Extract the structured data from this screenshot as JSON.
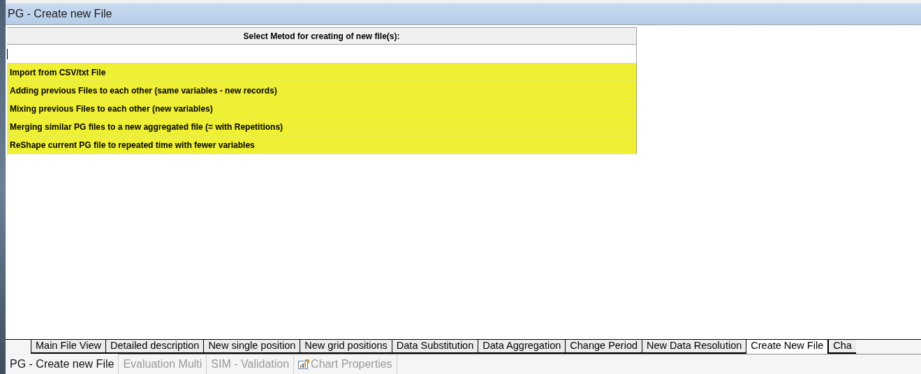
{
  "window": {
    "title": "PG - Create new File"
  },
  "grid": {
    "header": "Select Metod for creating of new file(s):",
    "methods": [
      {
        "label": "Import from CSV/txt File"
      },
      {
        "label": "Adding previous Files to each other (same variables - new records)"
      },
      {
        "label": "Mixing previous Files to each other (new variables)"
      },
      {
        "label": "Merging similar PG files to a new aggregated file (= with Repetitions)"
      },
      {
        "label": "ReShape current PG file to repeated time with fewer variables"
      }
    ]
  },
  "sheet_tabs": [
    {
      "label": "Main File View",
      "selected": false
    },
    {
      "label": "Detailed description",
      "selected": false
    },
    {
      "label": "New single position",
      "selected": false
    },
    {
      "label": "New grid positions",
      "selected": false
    },
    {
      "label": "Data Substitution",
      "selected": false
    },
    {
      "label": "Data Aggregation",
      "selected": false
    },
    {
      "label": "Change Period",
      "selected": false
    },
    {
      "label": "New Data Resolution",
      "selected": false
    },
    {
      "label": "Create New File",
      "selected": true
    },
    {
      "label": "Cha",
      "selected": false
    }
  ],
  "document_tabs": [
    {
      "label": "PG - Create new File",
      "selected": true,
      "icon": false
    },
    {
      "label": "Evaluation Multi",
      "selected": false,
      "icon": false
    },
    {
      "label": "SIM - Validation",
      "selected": false,
      "icon": false
    },
    {
      "label": "Chart Properties",
      "selected": false,
      "icon": true
    }
  ]
}
